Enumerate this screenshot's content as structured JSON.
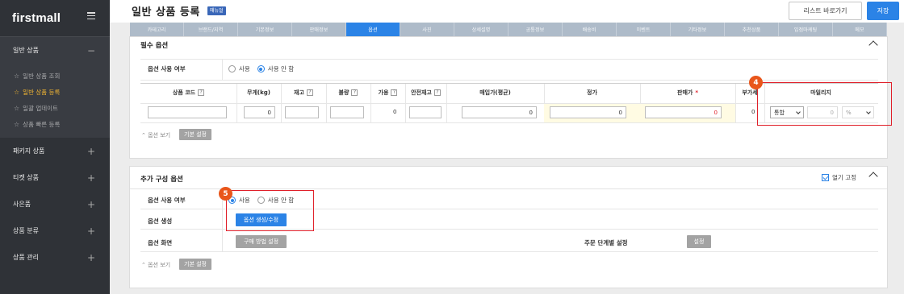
{
  "sidebar": {
    "logo": "firstmall",
    "groups": [
      {
        "label": "일반 상품",
        "sign": "−",
        "open": true
      },
      {
        "label": "패키지 상품",
        "sign": "+"
      },
      {
        "label": "티켓 상품",
        "sign": "+"
      },
      {
        "label": "사은품",
        "sign": "+"
      },
      {
        "label": "상품 분류",
        "sign": "+"
      },
      {
        "label": "상품 관리",
        "sign": "+"
      }
    ],
    "subitems": [
      {
        "label": "일반 상품 조회",
        "active": false
      },
      {
        "label": "일반 상품 등록",
        "active": true
      },
      {
        "label": "일괄 업데이트",
        "active": false
      },
      {
        "label": "상품 빠른 등록",
        "active": false
      }
    ]
  },
  "header": {
    "title": "일반 상품 등록",
    "manual_badge": "매뉴얼",
    "list_button": "리스트 바로가기",
    "save_button": "저장",
    "collapse_icon": "‹"
  },
  "tabs": [
    "카테고리",
    "브랜드/지역",
    "기본정보",
    "판매정보",
    "옵션",
    "사진",
    "상세설명",
    "공통정보",
    "배송비",
    "이벤트",
    "기타정보",
    "추천상품",
    "입점마케팅",
    "메모"
  ],
  "active_tab": "옵션",
  "required_options": {
    "title": "필수 옵션",
    "use_label": "옵션 사용 여부",
    "radio_use": "사용",
    "radio_not_use": "사용 안 함",
    "columns": [
      "상품 코드",
      "무게(kg)",
      "재고",
      "불량",
      "가용",
      "안전재고",
      "매입가(평균)",
      "정가",
      "판매가",
      "부가세",
      "마일리지"
    ],
    "values": {
      "weight": "0",
      "available": "0",
      "purchase": "0",
      "list_price": "0",
      "sale_price": "0",
      "vat": "0",
      "mileage": "0"
    },
    "required_mark": "*",
    "mileage_type": "통합",
    "mileage_unit": "%",
    "view_label": "옵션 보기",
    "default_btn": "기본 설정",
    "marker": "4"
  },
  "extra_options": {
    "title": "추가 구성 옵션",
    "pin_label": "열기 고정",
    "use_label": "옵션 사용 여부",
    "radio_use": "사용",
    "radio_not_use": "사용 안 함",
    "create_label": "옵션 생성",
    "create_btn": "옵션 생성/수정",
    "screen_label": "옵션 화면",
    "purchase_method_btn": "구매 방법 설정",
    "order_step_label": "주문 단계별 설정",
    "order_step_btn": "설정",
    "view_label": "옵션 보기",
    "default_btn": "기본 설정",
    "marker": "5"
  },
  "colors": {
    "accent": "#2b83e6",
    "sidebar": "#2f3237",
    "marker": "#e9561b",
    "highlight": "#e0202a",
    "active_menu": "#f2b632"
  }
}
